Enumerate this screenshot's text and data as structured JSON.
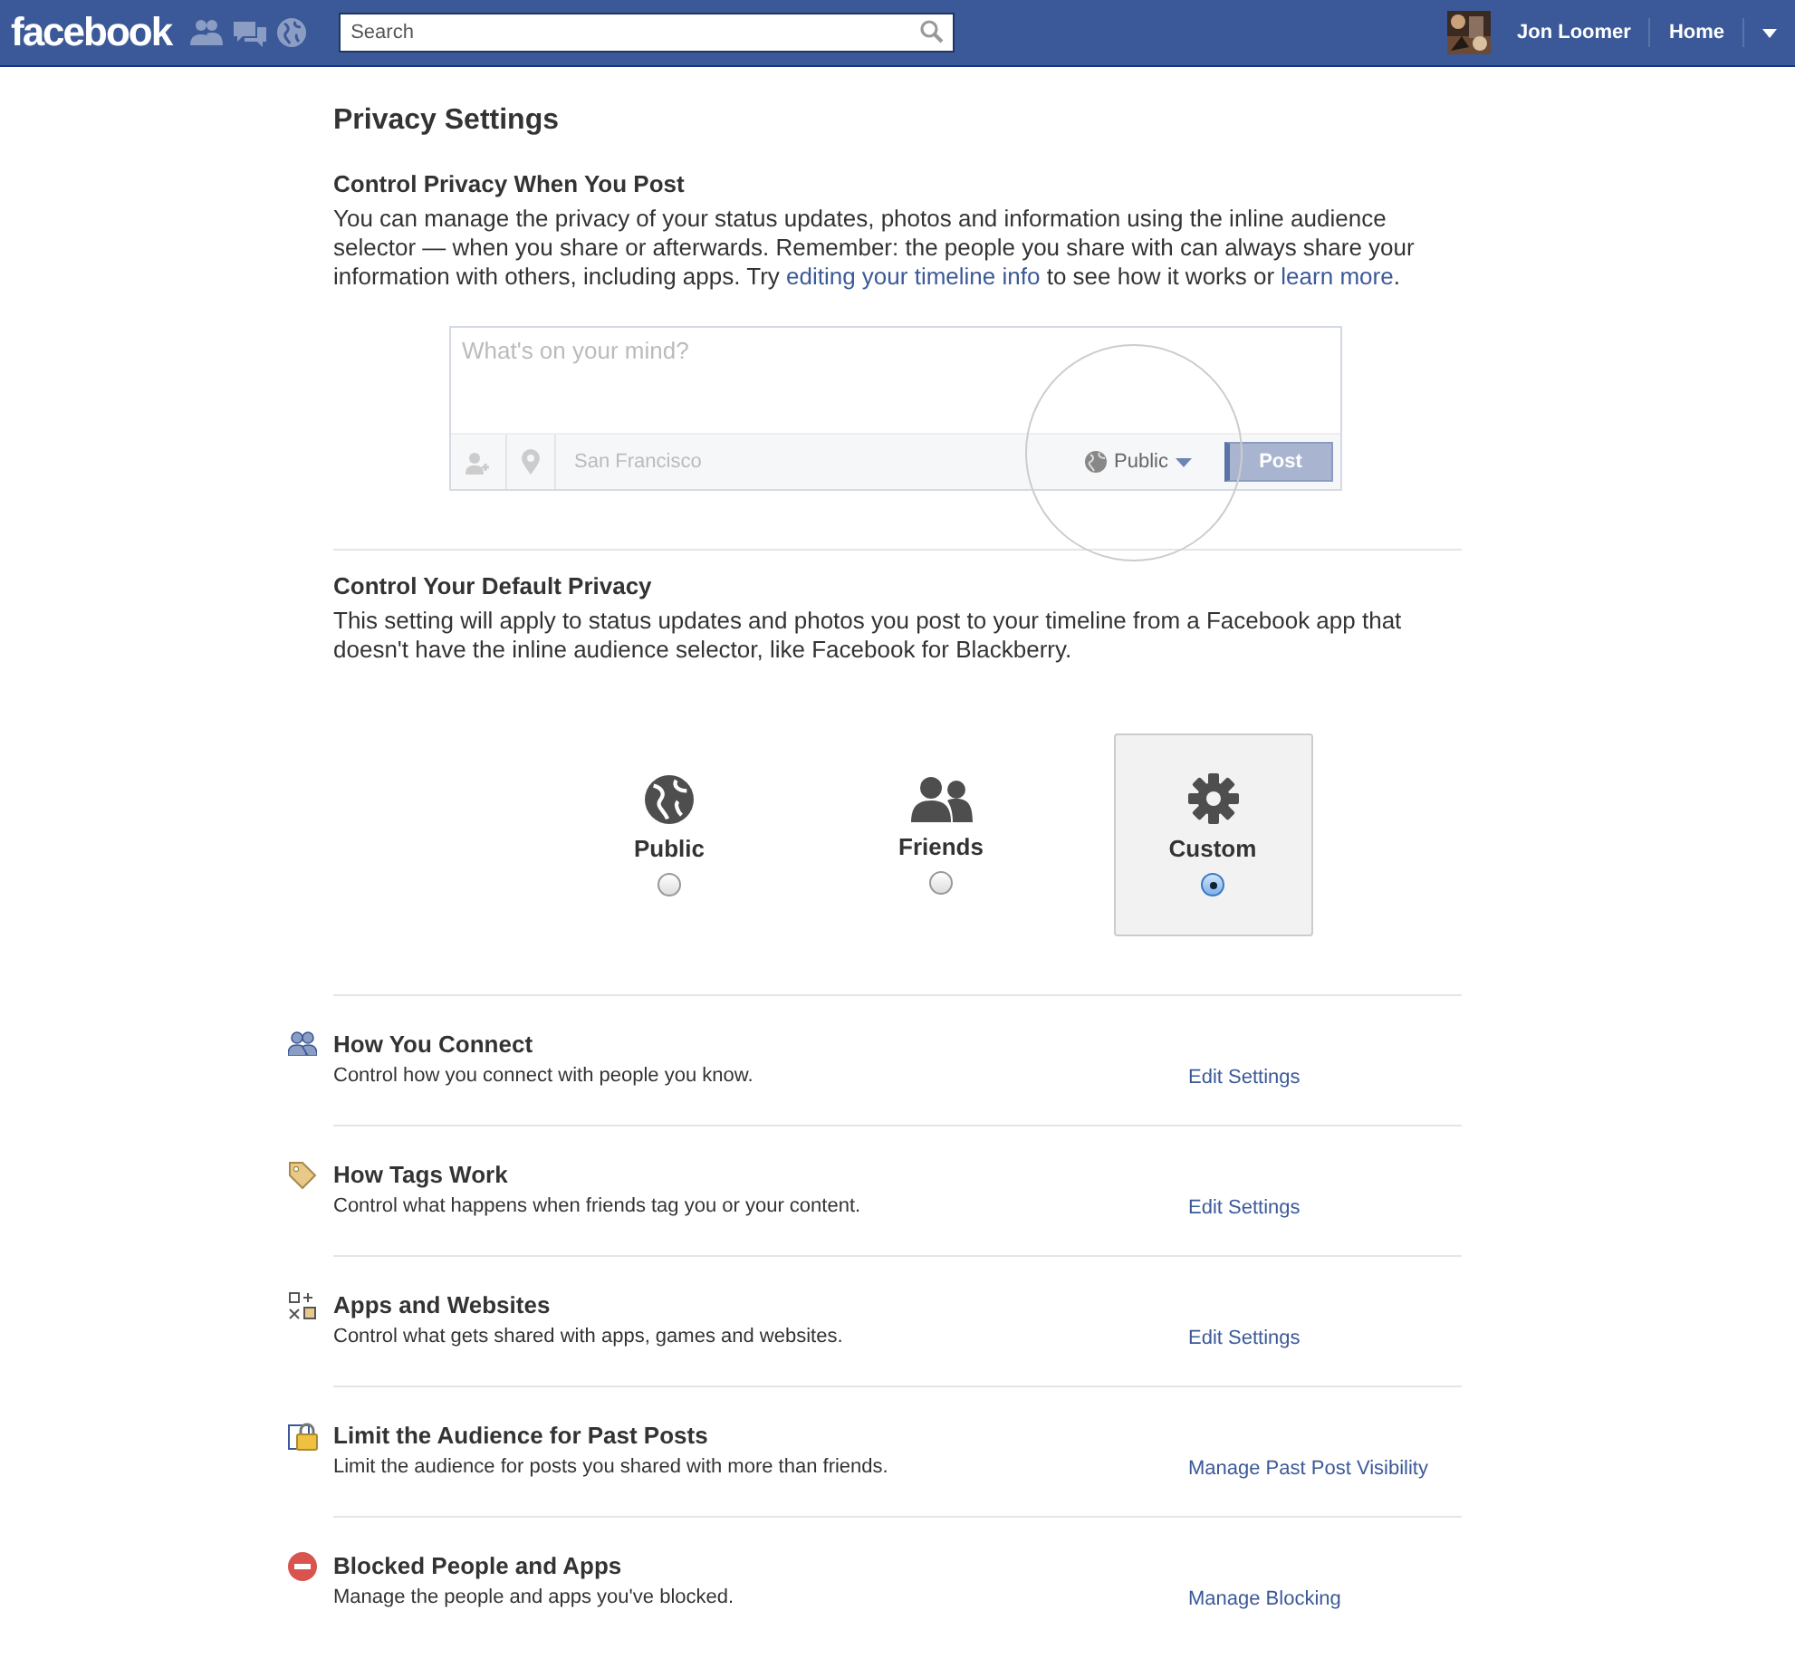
{
  "top_bar": {
    "logo": "facebook",
    "search": {
      "placeholder": "Search"
    },
    "user_name": "Jon Loomer",
    "home_link": "Home"
  },
  "page_title": "Privacy Settings",
  "post_section": {
    "heading": "Control Privacy When You Post",
    "intro": [
      {
        "kind": "text",
        "text": "You can manage the privacy of your status updates, photos and information using the inline audience selector — when you share or afterwards. Remember: the people you share with can always share your information with others, including apps. Try "
      },
      {
        "kind": "link",
        "text": "editing your timeline info"
      },
      {
        "kind": "text",
        "text": " to see how it works or "
      },
      {
        "kind": "link",
        "text": "learn more"
      },
      {
        "kind": "text",
        "text": "."
      }
    ],
    "composer": {
      "placeholder": "What's on your mind?",
      "location": "San Francisco",
      "audience": "Public",
      "post_button": "Post"
    }
  },
  "default_section": {
    "heading": "Control Your Default Privacy",
    "description": "This setting will apply to status updates and photos you post to your timeline from a Facebook app that doesn't have the inline audience selector, like Facebook for Blackberry.",
    "options": [
      {
        "label": "Public",
        "selected": false
      },
      {
        "label": "Friends",
        "selected": false
      },
      {
        "label": "Custom",
        "selected": true
      }
    ]
  },
  "settings": [
    {
      "title": "How You Connect",
      "description": "Control how you connect with people you know.",
      "action": "Edit Settings"
    },
    {
      "title": "How Tags Work",
      "description": "Control what happens when friends tag you or your content.",
      "action": "Edit Settings"
    },
    {
      "title": "Apps and Websites",
      "description": "Control what gets shared with apps, games and websites.",
      "action": "Edit Settings"
    },
    {
      "title": "Limit the Audience for Past Posts",
      "description": "Limit the audience for posts you shared with more than friends.",
      "action": "Manage Past Post Visibility"
    },
    {
      "title": "Blocked People and Apps",
      "description": "Manage the people and apps you've blocked.",
      "action": "Manage Blocking"
    }
  ]
}
